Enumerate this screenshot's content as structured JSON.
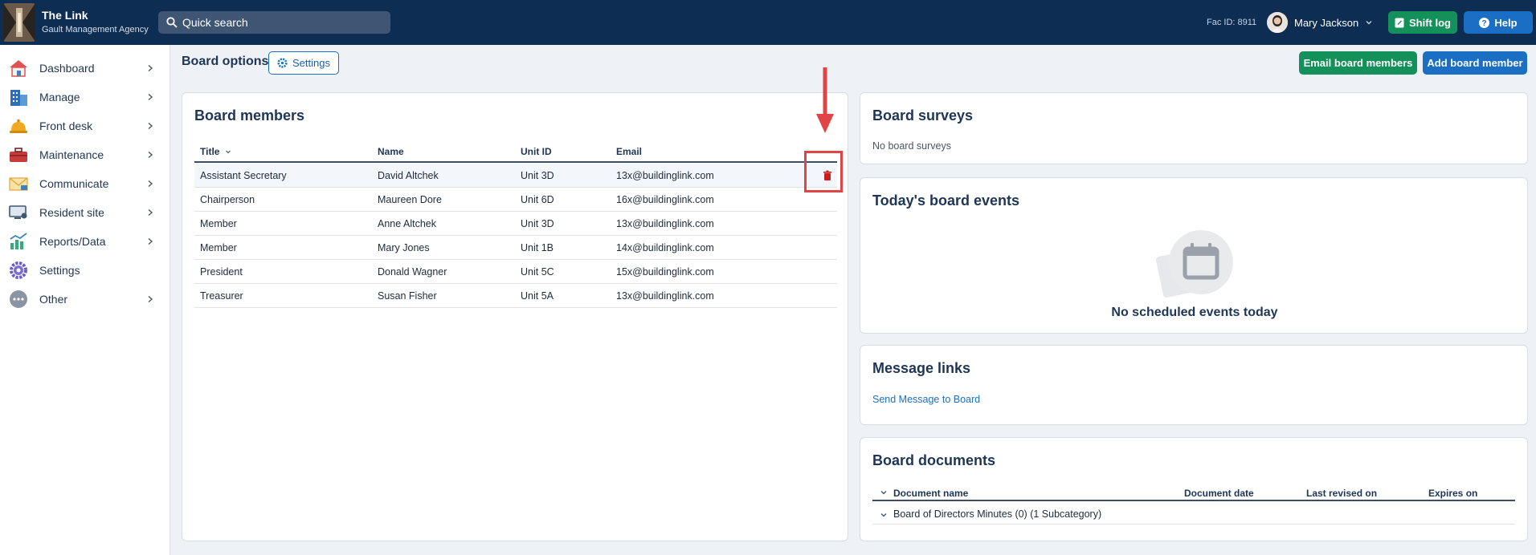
{
  "brand": {
    "title": "The Link",
    "subtitle": "Gault Management Agency"
  },
  "search": {
    "placeholder": "Quick search"
  },
  "header": {
    "fac_id": "Fac ID: 8911",
    "user_name": "Mary Jackson",
    "shift_log": "Shift log",
    "help": "Help"
  },
  "sidebar": {
    "items": [
      {
        "label": "Dashboard",
        "icon": "home-icon",
        "has_chevron": true
      },
      {
        "label": "Manage",
        "icon": "building-icon",
        "has_chevron": true
      },
      {
        "label": "Front desk",
        "icon": "bell-icon",
        "has_chevron": true
      },
      {
        "label": "Maintenance",
        "icon": "toolbox-icon",
        "has_chevron": true
      },
      {
        "label": "Communicate",
        "icon": "envelope-icon",
        "has_chevron": true
      },
      {
        "label": "Resident site",
        "icon": "monitor-icon",
        "has_chevron": true
      },
      {
        "label": "Reports/Data",
        "icon": "chart-icon",
        "has_chevron": true
      },
      {
        "label": "Settings",
        "icon": "gear-icon",
        "has_chevron": false
      },
      {
        "label": "Other",
        "icon": "ellipsis-icon",
        "has_chevron": true
      }
    ]
  },
  "page": {
    "title": "Board options",
    "settings": "Settings",
    "email_btn": "Email board members",
    "add_btn": "Add board member"
  },
  "members": {
    "title": "Board members",
    "columns": {
      "title": "Title",
      "name": "Name",
      "unit": "Unit ID",
      "email": "Email"
    },
    "rows": [
      {
        "title": "Assistant Secretary",
        "name": "David Altchek",
        "unit": "Unit 3D",
        "email": "13x@buildinglink.com"
      },
      {
        "title": "Chairperson",
        "name": "Maureen Dore",
        "unit": "Unit 6D",
        "email": "16x@buildinglink.com"
      },
      {
        "title": "Member",
        "name": "Anne Altchek",
        "unit": "Unit 3D",
        "email": "13x@buildinglink.com"
      },
      {
        "title": "Member",
        "name": "Mary Jones",
        "unit": "Unit 1B",
        "email": "14x@buildinglink.com"
      },
      {
        "title": "President",
        "name": "Donald Wagner",
        "unit": "Unit 5C",
        "email": "15x@buildinglink.com"
      },
      {
        "title": "Treasurer",
        "name": "Susan Fisher",
        "unit": "Unit 5A",
        "email": "13x@buildinglink.com"
      }
    ]
  },
  "surveys": {
    "title": "Board surveys",
    "empty": "No board surveys"
  },
  "events": {
    "title": "Today's board events",
    "empty": "No scheduled events today"
  },
  "links": {
    "title": "Message links",
    "send": "Send Message to Board"
  },
  "docs": {
    "title": "Board documents",
    "columns": {
      "name": "Document name",
      "date": "Document date",
      "revised": "Last revised on",
      "expires": "Expires on"
    },
    "rows": [
      {
        "name": "Board of Directors Minutes (0) (1 Subcategory)"
      }
    ]
  },
  "colors": {
    "topbar": "#0d2d53",
    "green": "#14905a",
    "blue": "#1a6fc4",
    "highlight": "#e04444"
  }
}
